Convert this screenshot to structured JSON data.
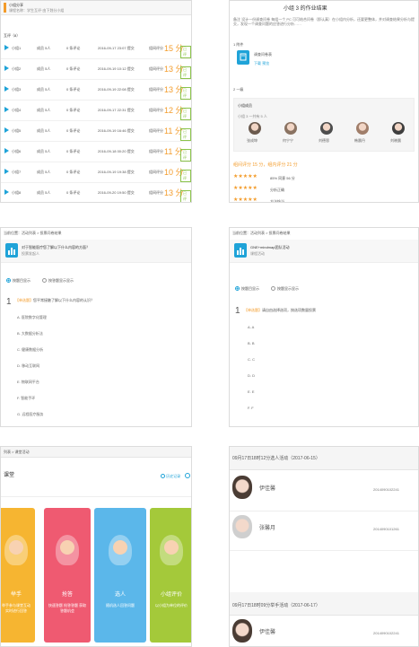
{
  "p1": {
    "title": "小组分享",
    "subtitle": "课程名称：学生互评·由下划分小组",
    "section": "互评（8）",
    "rows": [
      {
        "name": "小组1",
        "members": "成员 5人",
        "comments": "0 条评论",
        "date": "2016-09-17 23:07 提交",
        "label": "组间评分",
        "score": "15 分",
        "btn": "已评"
      },
      {
        "name": "小组2",
        "members": "成员 5人",
        "comments": "0 条评论",
        "date": "2016-09-19 10:12 提交",
        "label": "组间评分",
        "score": "13 分",
        "btn": "已评"
      },
      {
        "name": "小组3",
        "members": "成员 5人",
        "comments": "0 条评论",
        "date": "2016-09-19 22:08 提交",
        "label": "组间评分",
        "score": "13 分",
        "btn": "已评"
      },
      {
        "name": "小组4",
        "members": "成员 5人",
        "comments": "0 条评论",
        "date": "2016-09-17 22:31 提交",
        "label": "组间评分",
        "score": "12 分",
        "btn": "已评"
      },
      {
        "name": "小组5",
        "members": "成员 5人",
        "comments": "0 条评论",
        "date": "2016-09-19 16:46 提交",
        "label": "组间评分",
        "score": "11 分",
        "btn": "已评"
      },
      {
        "name": "小组6",
        "members": "成员 5人",
        "comments": "0 条评论",
        "date": "2016-09-18 00:20 提交",
        "label": "组间评分",
        "score": "11 分",
        "btn": "已评"
      },
      {
        "name": "小组7",
        "members": "成员 5人",
        "comments": "0 条评论",
        "date": "2016-09-19 19:38 提交",
        "label": "组间评分",
        "score": "10 分",
        "btn": "已评"
      },
      {
        "name": "小组8",
        "members": "成员 5人",
        "comments": "0 条评论",
        "date": "2016-09-20 19:50 提交",
        "label": "组间评分",
        "score": "13 分",
        "btn": "已评"
      }
    ]
  },
  "p2": {
    "title": "小组 3 的作业结果",
    "intro": "备注 设计一份调查问卷 每组一个 PC 可可结合问卷（即认真）在小组内分析，还要更整体，并对调查结果分析与提交，发现一个调查问题的应答进行分析……",
    "file_label": "1 附件",
    "file_name": "调查问卷表",
    "file_actions": "下载  预览",
    "section2": "2 一级",
    "members_title": "小组成员",
    "members_sub": "小组 3 一共有 5 人",
    "members": [
      "张成坤",
      "何宁宁",
      "刘德恩",
      "韩晨丹",
      "刘晓晨"
    ],
    "score_line": "组间评分 15 分，组内评分 21 分",
    "ratings": [
      "85% 同意 56 分",
      "分析正确",
      "方法恰当"
    ]
  },
  "p3": {
    "breadcrumb": "当前位置：活动列表 > 投票问卷结果",
    "title": "对于智能医疗您了解以下什么内容的方面？",
    "subtitle": "投票发起人",
    "mode_a": "按题目显示",
    "mode_b": "按答题显示显示",
    "q_num": "1",
    "q_tag": "【单选题】",
    "q_text": "您平常接触了解以下什么内容的认识？",
    "options": [
      "A. 医院数字化管理",
      "B. 大数据分析法",
      "C. 健康数据分析",
      "D. 移动互联网",
      "E. 物联网平台",
      "F. 智能手环",
      "G. 远程医疗服务",
      "H. 其它领域"
    ]
  },
  "p4": {
    "breadcrumb": "当前位置：活动列表 > 投票问卷结果",
    "title": "GNE+mindmap团队活动",
    "subtitle": "课程活动",
    "mode_a": "按题目显示",
    "mode_b": "按题显示显示",
    "q_num": "1",
    "q_tag": "【单选题】",
    "q_text": "请自由选择选项，按选项数量投票",
    "options": [
      "A. A",
      "B. B",
      "C. C",
      "D. D",
      "E. E",
      "F. F"
    ]
  },
  "p5": {
    "breadcrumb": "列表 > 课堂活动",
    "title": "课堂",
    "history": "历史记录",
    "cards": [
      {
        "title": "举手",
        "desc": "举手参与课堂互动 实时进行回答",
        "color": "#f6b531"
      },
      {
        "title": "抢答",
        "desc": "快速答题 抢答答题 获取答题机会",
        "color": "#ef5a71"
      },
      {
        "title": "选人",
        "desc": "随机选人回答问题",
        "color": "#5bb7ea"
      },
      {
        "title": "小组评价",
        "desc": "以小组为单位的评价",
        "color": "#a4c93a"
      }
    ]
  },
  "p6": {
    "group1": "09月17日18时12分选人活动（2017-06-15）",
    "group2": "09月17日18时09分举手活动（2017-06-17）",
    "people1": [
      {
        "name": "伊佳馨",
        "id": "2014090102241"
      },
      {
        "name": "张馨月",
        "id": "2014090101261"
      }
    ],
    "people2": [
      {
        "name": "伊佳馨",
        "id": "2014090102241"
      }
    ]
  }
}
